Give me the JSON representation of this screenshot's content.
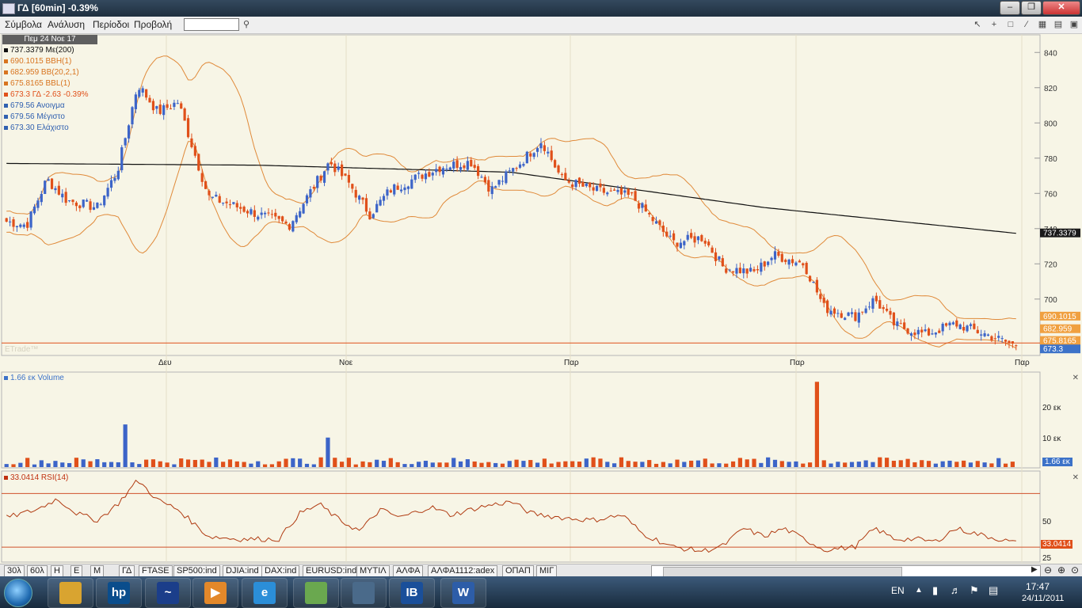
{
  "window": {
    "title": "ΓΔ [60min] -0.39%"
  },
  "menu": [
    "Σύμβολα",
    "Ανάλυση",
    "Περίοδοι",
    "Προβολή"
  ],
  "search": {
    "value": ""
  },
  "main_chart": {
    "date_label": "Πεμ 24 Νοε 17",
    "legend": [
      {
        "text": "737.3379 Με(200)",
        "color": "#111111"
      },
      {
        "text": "690.1015 BBH(1)",
        "color": "#d8741f"
      },
      {
        "text": "682.959 BB(20,2,1)",
        "color": "#d8741f"
      },
      {
        "text": "675.8165 BBL(1)",
        "color": "#d8741f"
      },
      {
        "text": "673.3 ΓΔ -2.63 -0.39%",
        "color": "#e0501a"
      },
      {
        "text": "679.56 Ανοιγμα",
        "color": "#3060b0"
      },
      {
        "text": "679.56 Μέγιστο",
        "color": "#3060b0"
      },
      {
        "text": "673.30 Ελάχιστο",
        "color": "#3060b0"
      }
    ],
    "axis_labels": [
      {
        "text": "840",
        "value": 840
      },
      {
        "text": "820",
        "value": 820
      },
      {
        "text": "800",
        "value": 800
      },
      {
        "text": "780",
        "value": 780
      },
      {
        "text": "760",
        "value": 760
      },
      {
        "text": "740",
        "value": 740
      },
      {
        "text": "720",
        "value": 720
      },
      {
        "text": "700",
        "value": 700
      }
    ],
    "price_tags": [
      {
        "text": "737.3379",
        "value": 737.3379,
        "bg": "#1a1a1a",
        "fg": "#ffffff"
      },
      {
        "text": "690.1015",
        "value": 690.1015,
        "bg": "#f0a040",
        "fg": "#ffffff"
      },
      {
        "text": "682.959",
        "value": 682.959,
        "bg": "#f0a040",
        "fg": "#ffffff"
      },
      {
        "text": "675.8165",
        "value": 675.8165,
        "bg": "#f0a040",
        "fg": "#ffffff"
      },
      {
        "text": "673.3",
        "value": 673.3,
        "bg": "#3c72c8",
        "fg": "#ffffff"
      }
    ],
    "watermark": "ΕTrade™",
    "x_labels": [
      "Δευ",
      "Νοε",
      "Παρ",
      "Παρ",
      "Παρ"
    ]
  },
  "volume_panel": {
    "legend": "1.66 εκ Volume",
    "axis_labels": [
      "20 εκ",
      "10 εκ"
    ],
    "last_tag": "1.66 εκ"
  },
  "rsi_panel": {
    "legend": "33.0414 RSI(14)",
    "axis_labels": [
      "50",
      "25"
    ],
    "last_tag": "33.0414"
  },
  "chart_data": {
    "type": "candlestick",
    "ylim": [
      668,
      850
    ],
    "series": [
      {
        "name": "Με(200)",
        "anchors": [
          [
            0,
            777
          ],
          [
            0.25,
            776
          ],
          [
            0.5,
            772
          ],
          [
            0.75,
            752
          ],
          [
            1,
            737.3379
          ]
        ]
      },
      {
        "name": "BBH(1)",
        "last": 690.1015
      },
      {
        "name": "BB(20,2,1)",
        "last": 682.959
      },
      {
        "name": "BBL(1)",
        "last": 675.8165
      },
      {
        "name": "ΓΔ",
        "last": 673.3
      }
    ],
    "close_anchors": [
      [
        0,
        744
      ],
      [
        0.02,
        742
      ],
      [
        0.04,
        768
      ],
      [
        0.06,
        756
      ],
      [
        0.09,
        752
      ],
      [
        0.11,
        773
      ],
      [
        0.13,
        822
      ],
      [
        0.15,
        806
      ],
      [
        0.17,
        812
      ],
      [
        0.2,
        758
      ],
      [
        0.24,
        750
      ],
      [
        0.28,
        742
      ],
      [
        0.3,
        760
      ],
      [
        0.32,
        778
      ],
      [
        0.34,
        765
      ],
      [
        0.36,
        748
      ],
      [
        0.38,
        762
      ],
      [
        0.41,
        770
      ],
      [
        0.43,
        775
      ],
      [
        0.46,
        778
      ],
      [
        0.48,
        762
      ],
      [
        0.51,
        778
      ],
      [
        0.53,
        790
      ],
      [
        0.55,
        768
      ],
      [
        0.58,
        762
      ],
      [
        0.62,
        758
      ],
      [
        0.64,
        745
      ],
      [
        0.66,
        732
      ],
      [
        0.69,
        735
      ],
      [
        0.71,
        718
      ],
      [
        0.74,
        715
      ],
      [
        0.76,
        725
      ],
      [
        0.79,
        720
      ],
      [
        0.81,
        695
      ],
      [
        0.84,
        690
      ],
      [
        0.86,
        700
      ],
      [
        0.88,
        685
      ],
      [
        0.91,
        680
      ],
      [
        0.94,
        686
      ],
      [
        0.97,
        680
      ],
      [
        1,
        673.3
      ]
    ],
    "volume_unit": "εκ",
    "volume_ylim": [
      0,
      28
    ],
    "volume_last": 1.66,
    "volume_spike": {
      "at": 0.8,
      "value": 26
    },
    "volume_tall": [
      {
        "at": 0.12,
        "value": 13
      },
      {
        "at": 0.32,
        "value": 9
      }
    ],
    "rsi_lines": [
      70,
      30
    ],
    "rsi_ylim": [
      20,
      85
    ],
    "rsi_last": 33.0414,
    "rsi_anchors": [
      [
        0,
        52
      ],
      [
        0.03,
        58
      ],
      [
        0.05,
        66
      ],
      [
        0.07,
        55
      ],
      [
        0.09,
        50
      ],
      [
        0.11,
        62
      ],
      [
        0.13,
        80
      ],
      [
        0.15,
        65
      ],
      [
        0.17,
        58
      ],
      [
        0.2,
        38
      ],
      [
        0.23,
        36
      ],
      [
        0.27,
        36
      ],
      [
        0.29,
        55
      ],
      [
        0.31,
        62
      ],
      [
        0.33,
        50
      ],
      [
        0.35,
        42
      ],
      [
        0.37,
        58
      ],
      [
        0.39,
        52
      ],
      [
        0.42,
        60
      ],
      [
        0.44,
        54
      ],
      [
        0.47,
        60
      ],
      [
        0.5,
        64
      ],
      [
        0.52,
        55
      ],
      [
        0.55,
        52
      ],
      [
        0.58,
        50
      ],
      [
        0.61,
        54
      ],
      [
        0.63,
        40
      ],
      [
        0.66,
        30
      ],
      [
        0.69,
        27
      ],
      [
        0.71,
        31
      ],
      [
        0.73,
        44
      ],
      [
        0.75,
        38
      ],
      [
        0.77,
        44
      ],
      [
        0.79,
        36
      ],
      [
        0.81,
        28
      ],
      [
        0.84,
        30
      ],
      [
        0.86,
        44
      ],
      [
        0.88,
        36
      ],
      [
        0.9,
        36
      ],
      [
        0.92,
        34
      ],
      [
        0.94,
        44
      ],
      [
        0.96,
        40
      ],
      [
        1,
        33
      ]
    ]
  },
  "bottom_tabs": [
    "30λ",
    "60λ",
    "Η",
    "Ε",
    "Μ",
    "ΓΔ",
    "FTASE",
    "SP500:ind",
    "DJIA:ind",
    "DAX:ind",
    "EURUSD:ind",
    "ΜΥΤΙΛ",
    "ΑΛΦΑ",
    "ΑΛΦΑ1112:adex",
    "ΟΠΑΠ",
    "ΜΙΓ"
  ],
  "taskbar": {
    "apps": [
      {
        "name": "explorer",
        "label": "",
        "color": "#d9a430"
      },
      {
        "name": "hp",
        "label": "hp",
        "color": "#0a4d8c"
      },
      {
        "name": "trading",
        "label": "~",
        "color": "#1b3e8a"
      },
      {
        "name": "media",
        "label": "▶",
        "color": "#e3882a"
      },
      {
        "name": "ie",
        "label": "e",
        "color": "#2b8ed8"
      },
      {
        "name": "network",
        "label": "",
        "color": "#6aa84f"
      },
      {
        "name": "etrade",
        "label": "",
        "color": "#4a6a8a"
      },
      {
        "name": "ib",
        "label": "IB",
        "color": "#1a4f9a"
      },
      {
        "name": "word",
        "label": "W",
        "color": "#2d5da8"
      }
    ],
    "lang": "EN",
    "time": "17:47",
    "date": "24/11/2011"
  }
}
